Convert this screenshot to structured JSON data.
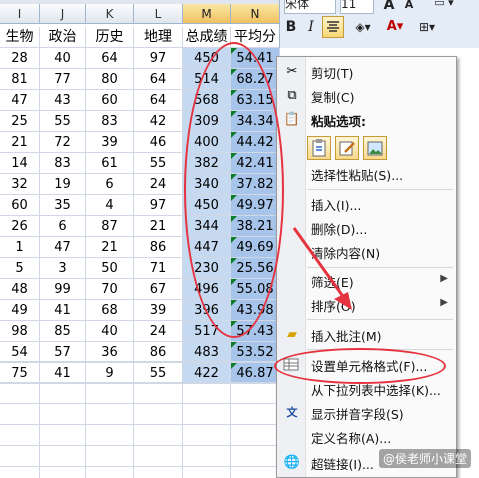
{
  "columns": [
    {
      "letter": "I"
    },
    {
      "letter": "J"
    },
    {
      "letter": "K"
    },
    {
      "letter": "L"
    },
    {
      "letter": "M"
    },
    {
      "letter": "N"
    }
  ],
  "headers": [
    "生物",
    "政治",
    "历史",
    "地理",
    "总成绩",
    "平均分"
  ],
  "rows": [
    [
      "28",
      "40",
      "64",
      "97",
      "450",
      "54.41"
    ],
    [
      "81",
      "77",
      "80",
      "64",
      "514",
      "68.27"
    ],
    [
      "47",
      "43",
      "60",
      "64",
      "568",
      "63.15"
    ],
    [
      "25",
      "55",
      "83",
      "42",
      "309",
      "34.34"
    ],
    [
      "21",
      "72",
      "39",
      "46",
      "400",
      "44.42"
    ],
    [
      "14",
      "83",
      "61",
      "55",
      "382",
      "42.41"
    ],
    [
      "32",
      "19",
      "6",
      "24",
      "340",
      "37.82"
    ],
    [
      "60",
      "35",
      "4",
      "97",
      "450",
      "49.97"
    ],
    [
      "26",
      "6",
      "87",
      "21",
      "344",
      "38.21"
    ],
    [
      "1",
      "47",
      "21",
      "86",
      "447",
      "49.69"
    ],
    [
      "5",
      "3",
      "50",
      "71",
      "230",
      "25.56"
    ],
    [
      "48",
      "99",
      "70",
      "67",
      "496",
      "55.08"
    ],
    [
      "49",
      "41",
      "68",
      "39",
      "396",
      "43.98"
    ],
    [
      "98",
      "85",
      "40",
      "24",
      "517",
      "57.43"
    ],
    [
      "54",
      "57",
      "36",
      "86",
      "483",
      "53.52"
    ],
    [
      "75",
      "41",
      "9",
      "55",
      "422",
      "46.87"
    ]
  ],
  "ribbon": {
    "font_name": "宋体",
    "font_size": "11",
    "bold": "B",
    "italic": "I"
  },
  "context_menu": {
    "cut": "剪切(T)",
    "copy": "复制(C)",
    "paste_options": "粘贴选项:",
    "paste_special": "选择性粘贴(S)...",
    "insert": "插入(I)...",
    "delete": "删除(D)...",
    "clear": "清除内容(N)",
    "filter": "筛选(E)",
    "sort": "排序(O)",
    "insert_comment": "插入批注(M)",
    "format_cells": "设置单元格格式(F)...",
    "pick_list": "从下拉列表中选择(K)...",
    "phonetic": "显示拼音字段(S)",
    "define_name": "定义名称(A)...",
    "hyperlink": "超链接(I)..."
  },
  "watermark": "@侯老师小课堂",
  "colors": {
    "selection": "#c5d9f1",
    "annotation": "#e53340",
    "header_selected": "#f1c15f"
  }
}
